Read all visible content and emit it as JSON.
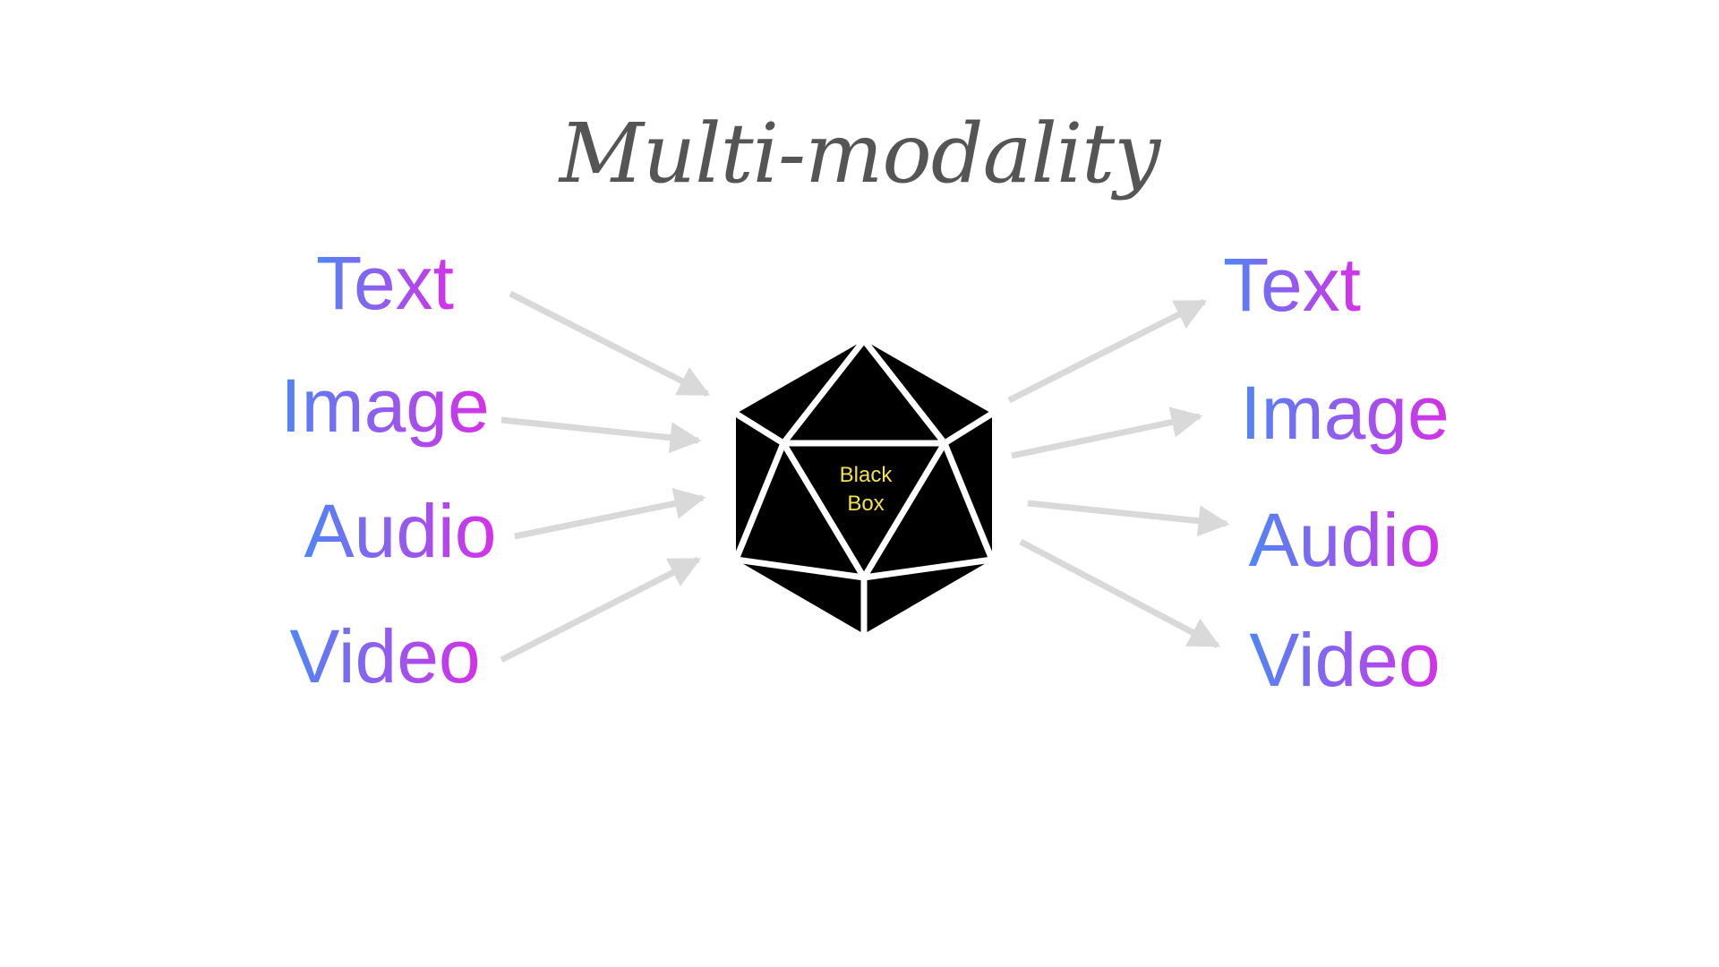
{
  "title": "Multi-modality",
  "inputs": [
    "Text",
    "Image",
    "Audio",
    "Video"
  ],
  "outputs": [
    "Text",
    "Image",
    "Audio",
    "Video"
  ],
  "center": {
    "label_line1": "Black",
    "label_line2": "Box"
  },
  "colors": {
    "title": "#555555",
    "gradient_start": "#4f86f5",
    "gradient_end": "#d630e8",
    "arrow": "#d9d9d9",
    "box_fill": "#000000",
    "box_lines": "#ffffff",
    "box_label": "#f2e24a"
  },
  "icons": {
    "center": "icosahedron-icon",
    "arrows": "arrow-icon"
  }
}
